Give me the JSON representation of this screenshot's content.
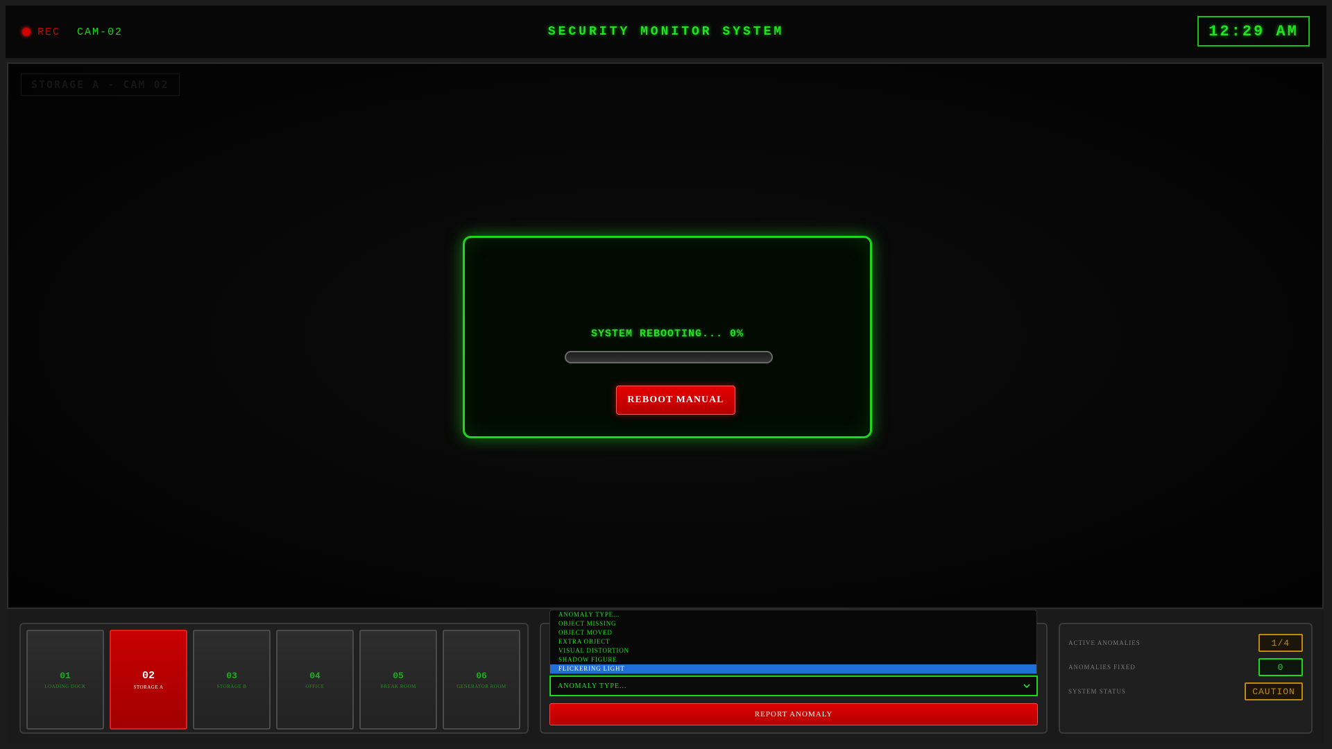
{
  "topbar": {
    "rec_label": "REC",
    "camera_id": "CAM-02",
    "title": "SECURITY MONITOR SYSTEM",
    "clock": "12:29 AM"
  },
  "viewport": {
    "overlay_label": "STORAGE A - CAM 02",
    "reboot": {
      "status_text": "SYSTEM REBOOTING... 0%",
      "progress": 0,
      "button_label": "REBOOT MANUAL"
    }
  },
  "cameras": [
    {
      "num": "01",
      "name": "LOADING DOCK",
      "active": false
    },
    {
      "num": "02",
      "name": "STORAGE A",
      "active": true
    },
    {
      "num": "03",
      "name": "STORAGE B",
      "active": false
    },
    {
      "num": "04",
      "name": "OFFICE",
      "active": false
    },
    {
      "num": "05",
      "name": "BREAK ROOM",
      "active": false
    },
    {
      "num": "06",
      "name": "GENERATOR ROOM",
      "active": false
    }
  ],
  "report": {
    "select_value": "ANOMALY TYPE...",
    "options": [
      "ANOMALY TYPE...",
      "OBJECT MISSING",
      "OBJECT MOVED",
      "EXTRA OBJECT",
      "VISUAL DISTORTION",
      "SHADOW FIGURE",
      "FLICKERING LIGHT"
    ],
    "highlighted_option": "FLICKERING LIGHT",
    "button_label": "REPORT ANOMALY"
  },
  "status": {
    "active_anomalies_label": "ACTIVE ANOMALIES",
    "active_anomalies_value": "1/4",
    "anomalies_fixed_label": "ANOMALIES FIXED",
    "anomalies_fixed_value": "0",
    "system_status_label": "SYSTEM STATUS",
    "system_status_value": "CAUTION"
  },
  "colors": {
    "accent_green": "#1fe41f",
    "alert_red": "#d40000",
    "caution_amber": "#c08a10",
    "highlight_blue": "#1f6fd8"
  }
}
